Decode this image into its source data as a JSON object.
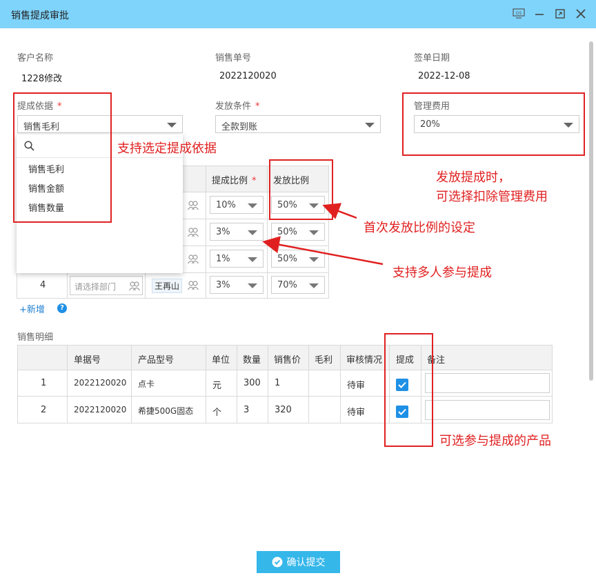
{
  "window": {
    "title": "销售提成审批"
  },
  "header_fields": {
    "customer_label": "客户名称",
    "customer_value": "1228修改",
    "order_label": "销售单号",
    "order_value": "2022120020",
    "date_label": "签单日期",
    "date_value": "2022-12-08"
  },
  "basis": {
    "label": "提成依据",
    "required": "*",
    "value": "销售毛利",
    "options": [
      "销售毛利",
      "销售金额",
      "销售数量"
    ]
  },
  "condition": {
    "label": "发放条件",
    "required": "*",
    "value": "全款到账"
  },
  "mgmt_fee": {
    "label": "管理费用",
    "value": "20%"
  },
  "commission_table": {
    "headers": {
      "ratio": "提成比例",
      "ratio_req": "*",
      "payout": "发放比例"
    },
    "rows": [
      {
        "ratio": "10%",
        "payout": "50%"
      },
      {
        "ratio": "3%",
        "payout": "50%"
      },
      {
        "ratio": "1%",
        "payout": "50%"
      },
      {
        "index": "4",
        "dept_placeholder": "请选择部门",
        "person": "王再山",
        "ratio": "3%",
        "payout": "70%"
      }
    ],
    "add_label": "+新增",
    "help_icon": "?"
  },
  "sales_detail": {
    "title": "销售明细",
    "headers": [
      "单据号",
      "产品型号",
      "单位",
      "数量",
      "销售价",
      "毛利",
      "审核情况",
      "提成",
      "备注"
    ],
    "rows": [
      {
        "index": "1",
        "doc": "2022120020",
        "model": "点卡",
        "unit": "元",
        "qty": "300",
        "price": "1",
        "profit": "",
        "status": "待审",
        "checked": true,
        "remark": ""
      },
      {
        "index": "2",
        "doc": "2022120020",
        "model": "希捷500G固态",
        "unit": "个",
        "qty": "3",
        "price": "320",
        "profit": "",
        "status": "待审",
        "checked": true,
        "remark": ""
      }
    ]
  },
  "annotations": {
    "basis_note": "支持选定提成依据",
    "fee_note_1": "发放提成时，",
    "fee_note_2": "可选择扣除管理费用",
    "payout_note": "首次发放比例的设定",
    "multi_note": "支持多人参与提成",
    "product_note": "可选参与提成的产品"
  },
  "submit_label": "确认提交",
  "colors": {
    "titlebar": "#7fd4fc",
    "accent": "#35b7ea",
    "annotation": "#e02020",
    "checkbox": "#1e90e6"
  }
}
